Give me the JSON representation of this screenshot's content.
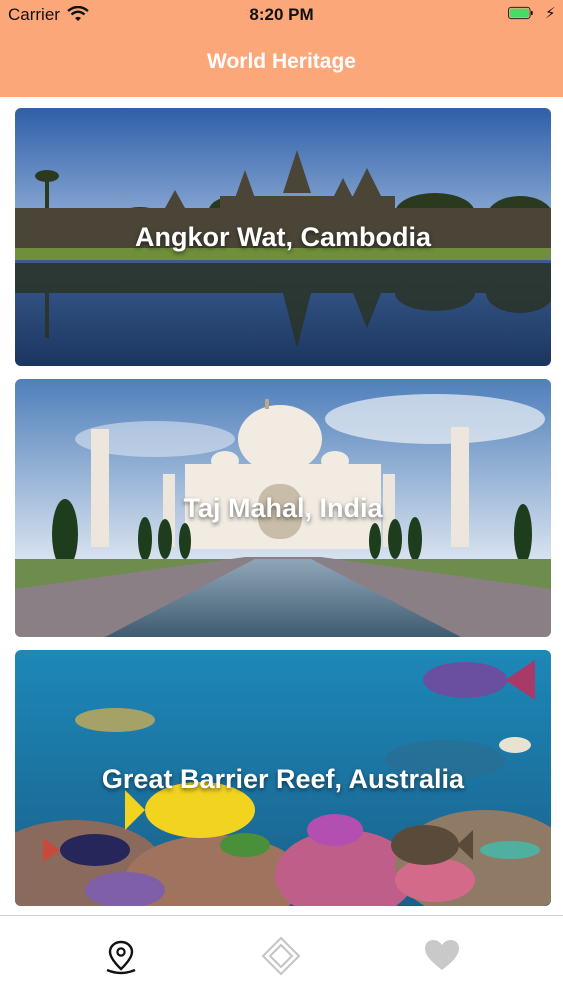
{
  "status_bar": {
    "carrier": "Carrier",
    "time": "8:20 PM",
    "battery_color": "#4cd964"
  },
  "header": {
    "title": "World Heritage",
    "background": "#fca77a"
  },
  "sites": [
    {
      "label": "Angkor Wat, Cambodia"
    },
    {
      "label": "Taj Mahal, India"
    },
    {
      "label": "Great Barrier Reef, Australia"
    }
  ],
  "tab_bar": {
    "tabs": [
      {
        "icon": "map-pin-icon",
        "selected": true
      },
      {
        "icon": "diamond-icon",
        "selected": false
      },
      {
        "icon": "heart-icon",
        "selected": false
      }
    ]
  }
}
